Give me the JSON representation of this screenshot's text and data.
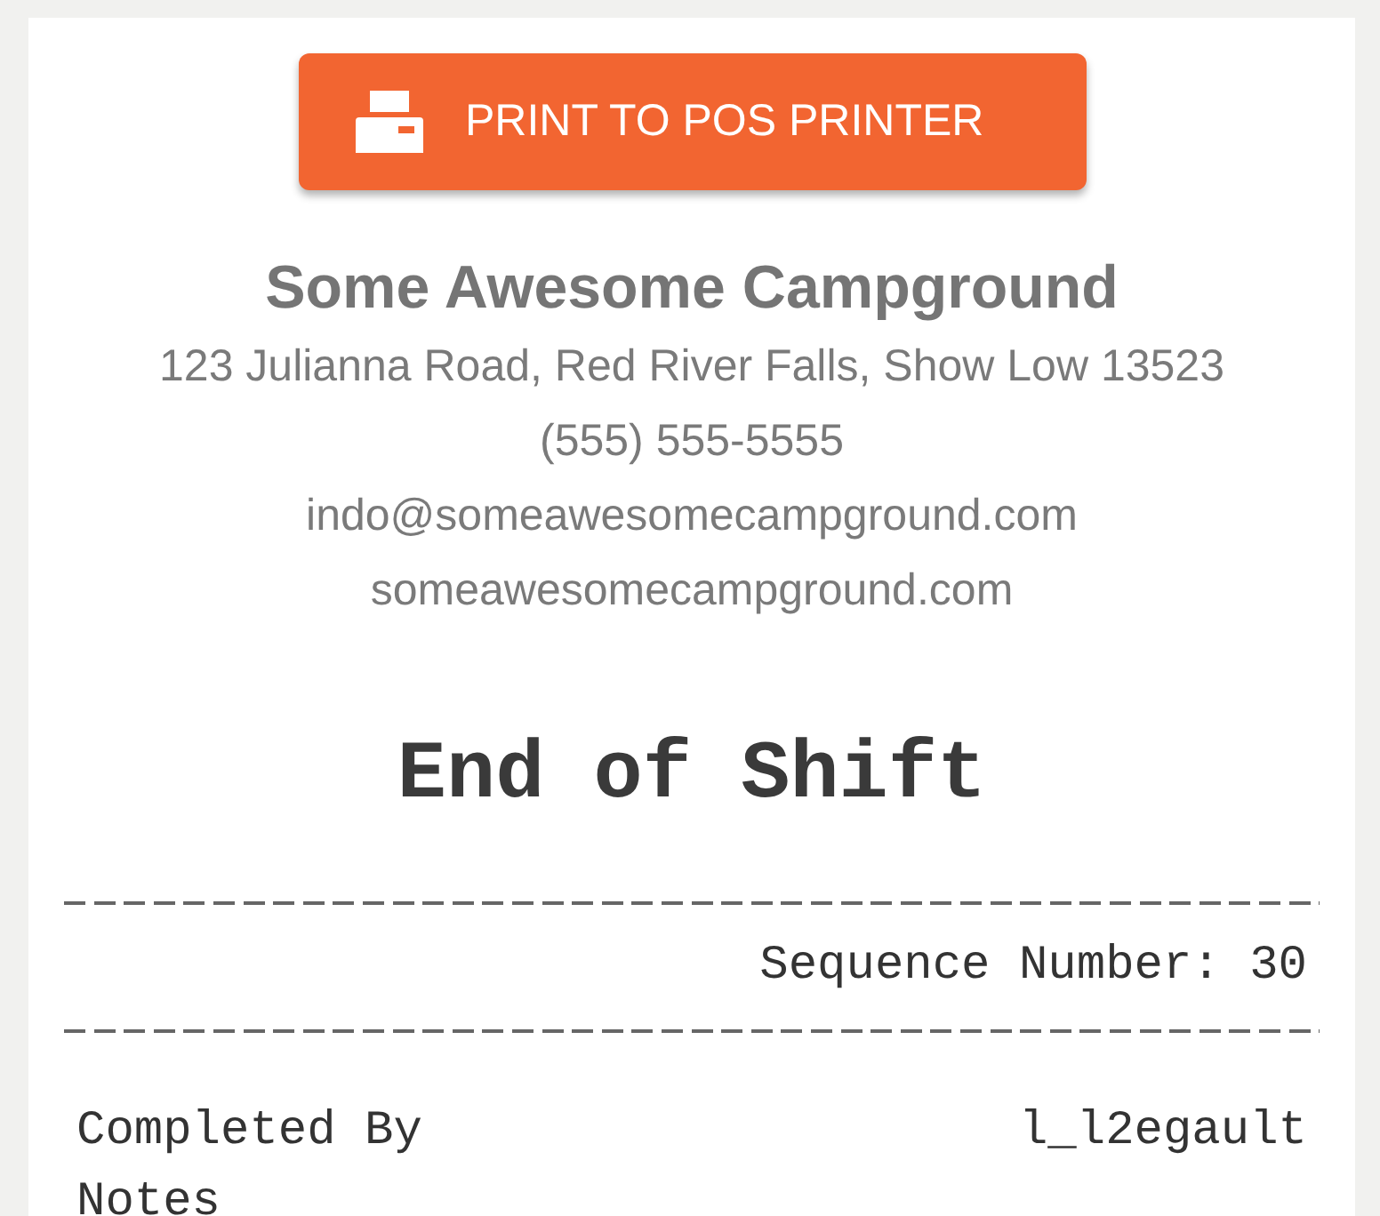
{
  "print_button": {
    "label": "PRINT TO POS PRINTER"
  },
  "business": {
    "name": "Some Awesome Campground",
    "address": "123 Julianna Road, Red River Falls, Show Low 13523",
    "phone": "(555) 555-5555",
    "email": "indo@someawesomecampground.com",
    "website": "someawesomecampground.com"
  },
  "receipt": {
    "title": "End of Shift",
    "sequence": "Sequence Number: 30",
    "fields": [
      {
        "label": "Completed By",
        "value": "l_l2egault"
      },
      {
        "label": "Notes"
      }
    ]
  }
}
